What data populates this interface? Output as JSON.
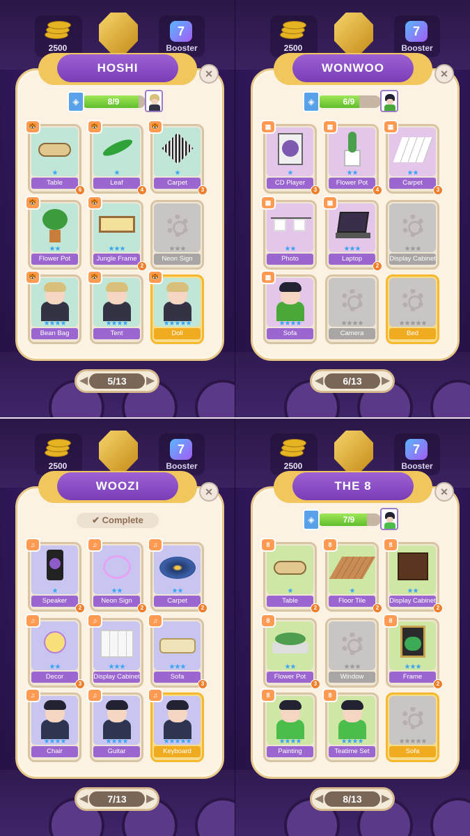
{
  "top_bar": {
    "coins": "2500",
    "booster_label": "Booster"
  },
  "panels": [
    {
      "title": "HOSHI",
      "progress_text": "8/9",
      "progress_fraction": 0.889,
      "complete_label": "",
      "page": "5/13",
      "badge_icon": "tiger-icon",
      "badge_text": "🐯",
      "hair": "#d8c07a",
      "body": "#333344",
      "bg": "#bfe6d6",
      "cards": [
        {
          "label": "Table",
          "stars": "★",
          "count": "6",
          "state": "normal",
          "thing": "table"
        },
        {
          "label": "Leaf",
          "stars": "★",
          "count": "4",
          "state": "normal",
          "thing": "leaf"
        },
        {
          "label": "Carpet",
          "stars": "★",
          "count": "3",
          "state": "normal",
          "thing": "carpet"
        },
        {
          "label": "Flower Pot",
          "stars": "★★",
          "count": "",
          "state": "normal",
          "thing": "plant"
        },
        {
          "label": "Jungle Frame",
          "stars": "★★★",
          "count": "2",
          "state": "normal",
          "thing": "frame"
        },
        {
          "label": "Neon Sign",
          "stars": "★★★",
          "count": "",
          "state": "grey",
          "thing": ""
        },
        {
          "label": "Bean Bag",
          "stars": "★★★★",
          "count": "",
          "state": "normal",
          "thing": "person"
        },
        {
          "label": "Tent",
          "stars": "★★★★",
          "count": "",
          "state": "normal",
          "thing": "person"
        },
        {
          "label": "Doll",
          "stars": "★★★★★",
          "count": "",
          "state": "gold",
          "thing": "person"
        }
      ]
    },
    {
      "title": "WONWOO",
      "progress_text": "6/9",
      "progress_fraction": 0.667,
      "complete_label": "",
      "page": "6/13",
      "badge_icon": "game-console-icon",
      "badge_text": "▦",
      "hair": "#222233",
      "body": "#4aa838",
      "bg": "#e3c6ea",
      "cards": [
        {
          "label": "CD Player",
          "stars": "★",
          "count": "3",
          "state": "normal",
          "thing": "cd"
        },
        {
          "label": "Flower Pot",
          "stars": "★★",
          "count": "4",
          "state": "normal",
          "thing": "cactus"
        },
        {
          "label": "Carpet",
          "stars": "★★",
          "count": "3",
          "state": "normal",
          "thing": "tiles"
        },
        {
          "label": "Photo",
          "stars": "★★",
          "count": "",
          "state": "normal",
          "thing": "photo"
        },
        {
          "label": "Laptop",
          "stars": "★★★",
          "count": "2",
          "state": "normal",
          "thing": "laptop"
        },
        {
          "label": "Display Cabinet",
          "stars": "★★★",
          "count": "",
          "state": "grey",
          "thing": ""
        },
        {
          "label": "Sofa",
          "stars": "★★★★",
          "count": "",
          "state": "normal",
          "thing": "person"
        },
        {
          "label": "Camera",
          "stars": "★★★★",
          "count": "",
          "state": "grey",
          "thing": ""
        },
        {
          "label": "Bed",
          "stars": "★★★★★",
          "count": "",
          "state": "goldgrey",
          "thing": ""
        }
      ]
    },
    {
      "title": "WOOZI",
      "progress_text": "",
      "progress_fraction": 1,
      "complete_label": "✔ Complete",
      "page": "7/13",
      "badge_icon": "music-icon",
      "badge_text": "♫",
      "hair": "#222233",
      "body": "#2d3550",
      "bg": "#c8c5f0",
      "cards": [
        {
          "label": "Speaker",
          "stars": "★",
          "count": "2",
          "state": "normal",
          "thing": "speaker"
        },
        {
          "label": "Neon Sign",
          "stars": "★★",
          "count": "2",
          "state": "normal",
          "thing": "neon"
        },
        {
          "label": "Carpet",
          "stars": "★★",
          "count": "2",
          "state": "normal",
          "thing": "rug"
        },
        {
          "label": "Decor",
          "stars": "★★",
          "count": "3",
          "state": "normal",
          "thing": "planet"
        },
        {
          "label": "Display Cabinet",
          "stars": "★★★",
          "count": "",
          "state": "normal",
          "thing": "shelf"
        },
        {
          "label": "Sofa",
          "stars": "★★★",
          "count": "3",
          "state": "normal",
          "thing": "sofa"
        },
        {
          "label": "Chair",
          "stars": "★★★★",
          "count": "",
          "state": "normal",
          "thing": "person"
        },
        {
          "label": "Guitar",
          "stars": "★★★★",
          "count": "",
          "state": "normal",
          "thing": "person"
        },
        {
          "label": "Keyboard",
          "stars": "★★★★★",
          "count": "",
          "state": "gold",
          "thing": "person"
        }
      ]
    },
    {
      "title": "THE 8",
      "progress_text": "7/9",
      "progress_fraction": 0.778,
      "complete_label": "",
      "page": "8/13",
      "badge_icon": "flag-8-icon",
      "badge_text": "8",
      "hair": "#222233",
      "body": "#4bbd4b",
      "bg": "#cfe7a4",
      "cards": [
        {
          "label": "Table",
          "stars": "★",
          "count": "2",
          "state": "normal",
          "thing": "table"
        },
        {
          "label": "Floor Tile",
          "stars": "★",
          "count": "2",
          "state": "normal",
          "thing": "floor"
        },
        {
          "label": "Display Cabinet",
          "stars": "★★",
          "count": "2",
          "state": "normal",
          "thing": "cabinet"
        },
        {
          "label": "Flower Pot",
          "stars": "★★",
          "count": "3",
          "state": "normal",
          "thing": "pots"
        },
        {
          "label": "Window",
          "stars": "★★★",
          "count": "",
          "state": "grey",
          "thing": ""
        },
        {
          "label": "Frame",
          "stars": "★★★",
          "count": "2",
          "state": "normal",
          "thing": "frog"
        },
        {
          "label": "Painting",
          "stars": "★★★★",
          "count": "",
          "state": "normal",
          "thing": "person"
        },
        {
          "label": "Teatime Set",
          "stars": "★★★★",
          "count": "",
          "state": "normal",
          "thing": "person"
        },
        {
          "label": "Sofa",
          "stars": "★★★★★",
          "count": "",
          "state": "goldgrey",
          "thing": ""
        }
      ]
    }
  ],
  "colors": {
    "accent_purple": "#8c4fc7",
    "progress_green": "#6ccd35",
    "gold": "#f5b82f",
    "star_blue": "#3aa4f1",
    "star_grey": "#9c9896"
  }
}
